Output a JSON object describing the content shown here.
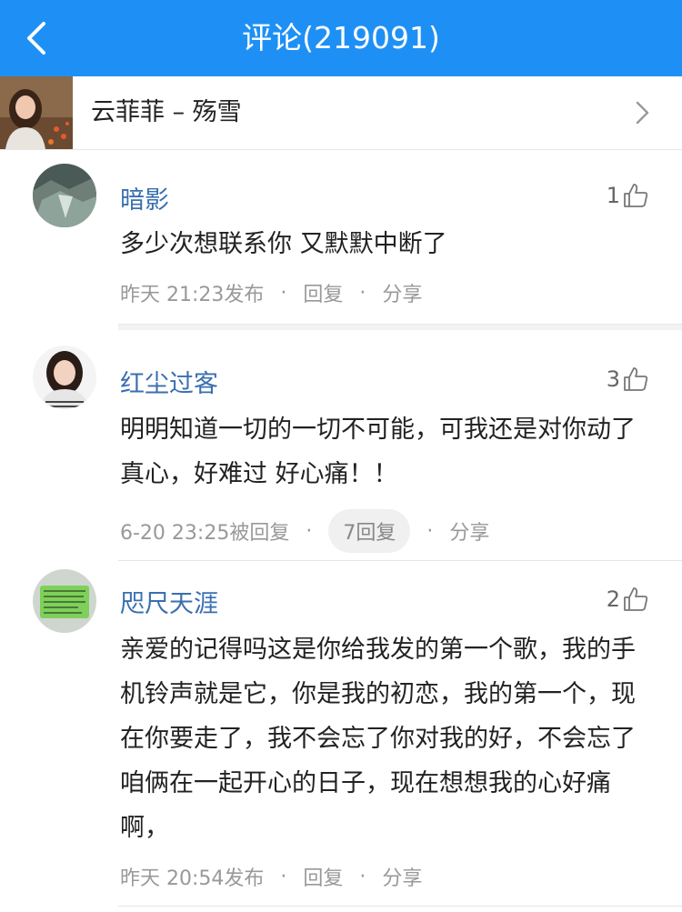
{
  "header": {
    "title": "评论(219091)"
  },
  "song": {
    "title": "云菲菲 – 殇雪"
  },
  "comments": [
    {
      "username": "暗影",
      "likes": "1",
      "text": "多少次想联系你   又默默中断了",
      "time": "昨天 21:23发布",
      "reply": "回复",
      "share": "分享"
    },
    {
      "username": "红尘过客",
      "likes": "3",
      "text": "明明知道一切的一切不可能，可我还是对你动了真心，好难过    好心痛！！",
      "time": "6-20 23:25被回复",
      "reply_count": "7回复",
      "share": "分享"
    },
    {
      "username": "咫尺天涯",
      "likes": "2",
      "text": "亲爱的记得吗这是你给我发的第一个歌，我的手机铃声就是它，你是我的初恋，我的第一个，现在你要走了，我不会忘了你对我的好，不会忘了咱俩在一起开心的日子，现在想想我的心好痛啊，",
      "time": "昨天 20:54发布",
      "reply": "回复",
      "share": "分享"
    }
  ],
  "colors": {
    "header_bg": "#1e90f5",
    "username": "#3a6fb0"
  },
  "icons": {
    "back": "back-chevron-icon",
    "song_chevron": "chevron-right-icon",
    "like": "thumb-up-icon"
  }
}
